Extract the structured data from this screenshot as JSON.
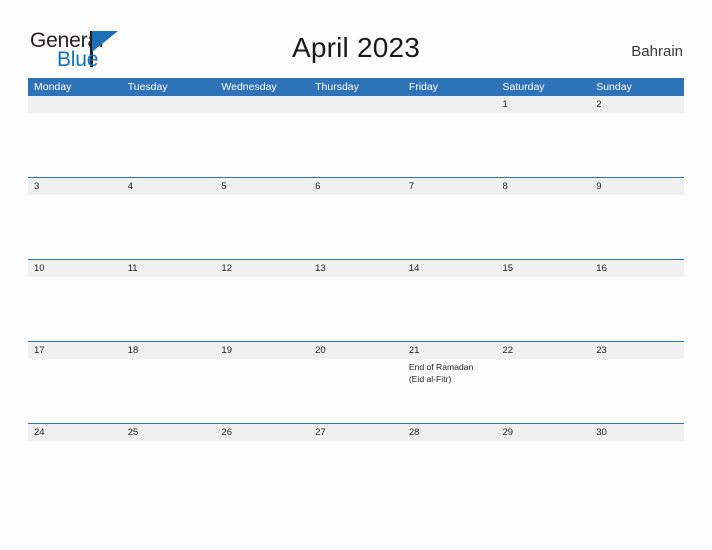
{
  "header": {
    "logo": {
      "line1": "General",
      "line2": "Blue",
      "triangle_icon": "blue-triangle-icon",
      "colors": {
        "text_dark": "#231f20",
        "text_blue": "#0e72c0",
        "triangle": "#1a6fb5"
      }
    },
    "title": "April 2023",
    "country": "Bahrain"
  },
  "calendar": {
    "accent_color": "#2e72b8",
    "band_color": "#f0f0f0",
    "weekdays": [
      "Monday",
      "Tuesday",
      "Wednesday",
      "Thursday",
      "Friday",
      "Saturday",
      "Sunday"
    ],
    "weeks": [
      [
        {
          "day": ""
        },
        {
          "day": ""
        },
        {
          "day": ""
        },
        {
          "day": ""
        },
        {
          "day": ""
        },
        {
          "day": "1"
        },
        {
          "day": "2"
        }
      ],
      [
        {
          "day": "3"
        },
        {
          "day": "4"
        },
        {
          "day": "5"
        },
        {
          "day": "6"
        },
        {
          "day": "7"
        },
        {
          "day": "8"
        },
        {
          "day": "9"
        }
      ],
      [
        {
          "day": "10"
        },
        {
          "day": "11"
        },
        {
          "day": "12"
        },
        {
          "day": "13"
        },
        {
          "day": "14"
        },
        {
          "day": "15"
        },
        {
          "day": "16"
        }
      ],
      [
        {
          "day": "17"
        },
        {
          "day": "18"
        },
        {
          "day": "19"
        },
        {
          "day": "20"
        },
        {
          "day": "21",
          "events": [
            "End of Ramadan",
            "(Eid al-Fitr)"
          ]
        },
        {
          "day": "22"
        },
        {
          "day": "23"
        }
      ],
      [
        {
          "day": "24"
        },
        {
          "day": "25"
        },
        {
          "day": "26"
        },
        {
          "day": "27"
        },
        {
          "day": "28"
        },
        {
          "day": "29"
        },
        {
          "day": "30"
        }
      ]
    ]
  }
}
